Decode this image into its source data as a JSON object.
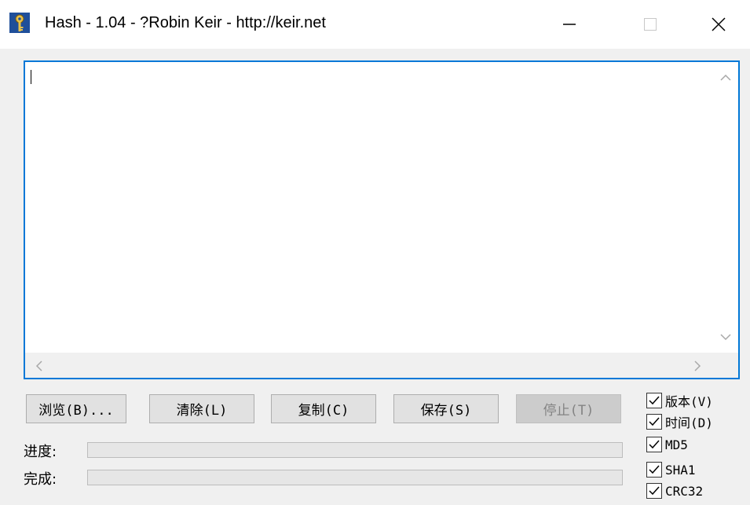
{
  "window": {
    "title": "Hash - 1.04 - ?Robin Keir - http://keir.net"
  },
  "icons": {
    "app": "key-icon",
    "minimize": "minimize-icon",
    "maximize": "maximize-icon",
    "close": "close-icon",
    "scroll_up": "chevron-up-icon",
    "scroll_down": "chevron-down-icon",
    "scroll_left": "chevron-left-icon",
    "scroll_right": "chevron-right-icon",
    "check": "check-icon"
  },
  "output": {
    "text": ""
  },
  "buttons": {
    "browse": "浏览(B)...",
    "clear": "清除(L)",
    "copy": "复制(C)",
    "save": "保存(S)",
    "stop": "停止(T)"
  },
  "progress": {
    "progress_label": "进度:",
    "progress_value": 0,
    "complete_label": "完成:",
    "complete_value": 0
  },
  "options": {
    "version": {
      "label": "版本(V)",
      "checked": true
    },
    "time": {
      "label": "时间(D)",
      "checked": true
    },
    "md5": {
      "label": "MD5",
      "checked": true
    },
    "sha1": {
      "label": "SHA1",
      "checked": true
    },
    "crc32": {
      "label": "CRC32",
      "checked": true
    }
  },
  "colors": {
    "focus_border": "#0078d7",
    "window_bg": "#f0f0f0"
  }
}
